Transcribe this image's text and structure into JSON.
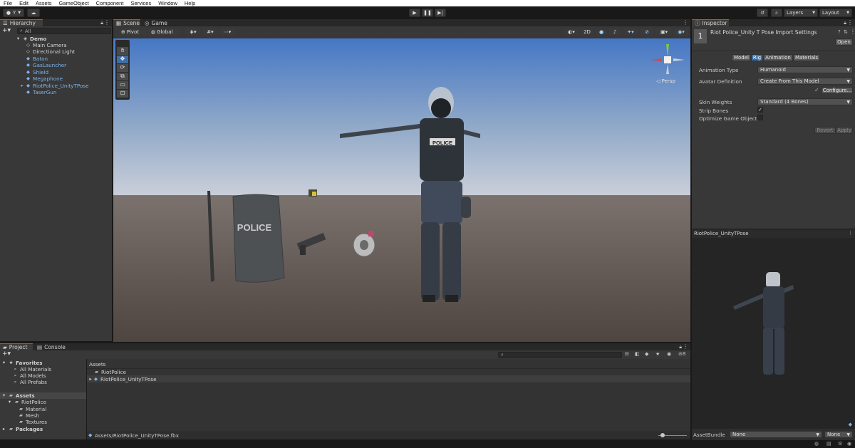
{
  "menu": [
    "File",
    "Edit",
    "Assets",
    "GameObject",
    "Component",
    "Services",
    "Window",
    "Help"
  ],
  "toolbar": {
    "account_label": "Y",
    "layers_label": "Layers",
    "layout_label": "Layout"
  },
  "hierarchy": {
    "tab_label": "Hierarchy",
    "search_placeholder": "All",
    "scene_name": "Demo",
    "items": [
      "Main Camera",
      "Directional Light",
      "Baton",
      "GasLauncher",
      "Shield",
      "Megaphone",
      "RiotPolice_UnityTPose",
      "TaserGun"
    ]
  },
  "scene": {
    "tabs": [
      "Scene",
      "Game"
    ],
    "pivot_label": "Pivot",
    "global_label": "Global",
    "mode_2d": "2D",
    "persp_label": "Persp",
    "vest_text": "POLICE",
    "shield_text": "POLICE"
  },
  "inspector": {
    "tab_label": "Inspector",
    "title": "Riot Police_Unity T Pose Import Settings",
    "open_label": "Open",
    "tabs": [
      "Model",
      "Rig",
      "Animation",
      "Materials"
    ],
    "animation_type_label": "Animation Type",
    "animation_type_value": "Humanoid",
    "avatar_definition_label": "Avatar Definition",
    "avatar_definition_value": "Create From This Model",
    "configure_label": "Configure...",
    "skin_weights_label": "Skin Weights",
    "skin_weights_value": "Standard (4 Bones)",
    "strip_bones_label": "Strip Bones",
    "optimize_label": "Optimize Game Objects",
    "revert_label": "Revert",
    "apply_label": "Apply",
    "preview_title": "RiotPolice_UnityTPose",
    "assetbundle_label": "AssetBundle",
    "assetbundle_value": "None",
    "assetbundle_variant": "None"
  },
  "project": {
    "tabs": [
      "Project",
      "Console"
    ],
    "favorites_label": "Favorites",
    "favorites": [
      "All Materials",
      "All Models",
      "All Prefabs"
    ],
    "assets_label": "Assets",
    "tree": [
      "RiotPolice",
      "Material",
      "Mesh",
      "Textures"
    ],
    "packages_label": "Packages",
    "breadcrumb": "Assets",
    "files": [
      "RiotPolice",
      "RiotPolice_UnityTPose"
    ],
    "footer_path": "Assets/RiotPolice_UnityTPose.fbx",
    "count_label": "8"
  },
  "colors": {
    "accent": "#3a79bb",
    "panel": "#383838",
    "link": "#7cb3ea"
  }
}
